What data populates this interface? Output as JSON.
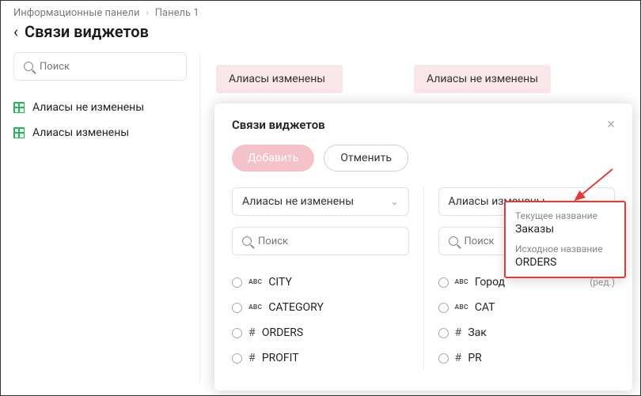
{
  "breadcrumb": {
    "root": "Информационные панели",
    "leaf": "Панель 1"
  },
  "page_title": "Связи виджетов",
  "sidebar": {
    "search_placeholder": "Поиск",
    "items": [
      {
        "label": "Алиасы не изменены"
      },
      {
        "label": "Алиасы изменены"
      }
    ]
  },
  "main_pills": [
    {
      "label": "Алиасы изменены"
    },
    {
      "label": "Алиасы не изменены"
    }
  ],
  "modal": {
    "title": "Связи виджетов",
    "add_label": "Добавить",
    "cancel_label": "Отменить",
    "left": {
      "dropdown": "Алиасы не изменены",
      "search_placeholder": "Поиск",
      "fields": [
        {
          "type": "ABC",
          "label": "CITY"
        },
        {
          "type": "ABC",
          "label": "CATEGORY"
        },
        {
          "type": "#",
          "label": "ORDERS"
        },
        {
          "type": "#",
          "label": "PROFIT"
        }
      ]
    },
    "right": {
      "dropdown": "Алиасы изменены",
      "search_placeholder": "Поиск",
      "fields": [
        {
          "type": "ABC",
          "label": "Город",
          "edited": "(ред.)"
        },
        {
          "type": "ABC",
          "label": "CAT"
        },
        {
          "type": "#",
          "label": "Зак"
        },
        {
          "type": "#",
          "label": "PR"
        }
      ]
    }
  },
  "tooltip": {
    "current_label": "Текущее название",
    "current_value": "Заказы",
    "original_label": "Исходное название",
    "original_value": "ORDERS"
  },
  "colors": {
    "accent_red": "#e53935",
    "pink_bg": "#f8e6e9",
    "pill_btn": "#f5c2c9",
    "grid_green": "#1db954"
  }
}
